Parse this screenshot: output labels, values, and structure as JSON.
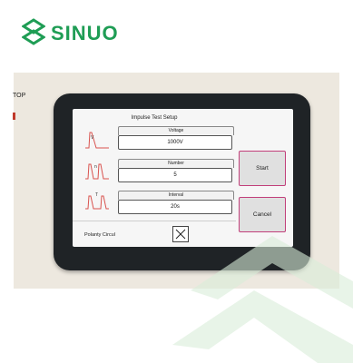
{
  "brand": {
    "name": "SINUO",
    "color": "#1f9d55"
  },
  "panel_label": "TOP",
  "screen": {
    "title": "Impulse Test Setup",
    "fields": [
      {
        "label": "Voltage",
        "value": "1000V",
        "icon": "voltage-waveform-icon",
        "icon_text": "V"
      },
      {
        "label": "Number",
        "value": "5",
        "icon": "pulse-count-waveform-icon",
        "icon_text": "n"
      },
      {
        "label": "Interval",
        "value": "20s",
        "icon": "interval-waveform-icon",
        "icon_text": "T"
      }
    ],
    "polarity_label": "Polanty Circul",
    "polarity_checked": true,
    "buttons": {
      "start": "Start",
      "cancel": "Cancel"
    },
    "accent": "#c13f7a",
    "wave_color": "#d9534f"
  }
}
